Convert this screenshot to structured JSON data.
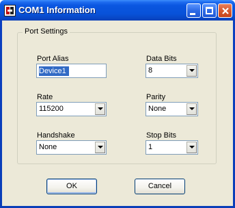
{
  "window": {
    "title": "COM1 Information",
    "buttons": [
      "minimize",
      "maximize",
      "close"
    ]
  },
  "group": {
    "legend": "Port Settings"
  },
  "fields": {
    "port_alias": {
      "label": "Port Alias",
      "value": "Device1"
    },
    "data_bits": {
      "label": "Data Bits",
      "value": "8"
    },
    "rate": {
      "label": "Rate",
      "value": "115200"
    },
    "parity": {
      "label": "Parity",
      "value": "None"
    },
    "handshake": {
      "label": "Handshake",
      "value": "None"
    },
    "stop_bits": {
      "label": "Stop Bits",
      "value": "1"
    }
  },
  "actions": {
    "ok_label": "OK",
    "cancel_label": "Cancel"
  },
  "icons": {
    "app": "serial-port-app-icon",
    "minimize": "minimize-icon",
    "maximize": "maximize-icon",
    "close": "close-icon",
    "dropdown": "chevron-down-icon"
  },
  "colors": {
    "titlebar": "#0852d9",
    "client": "#ece9d8",
    "selection": "#316ac5",
    "close_button": "#d75a2f"
  }
}
